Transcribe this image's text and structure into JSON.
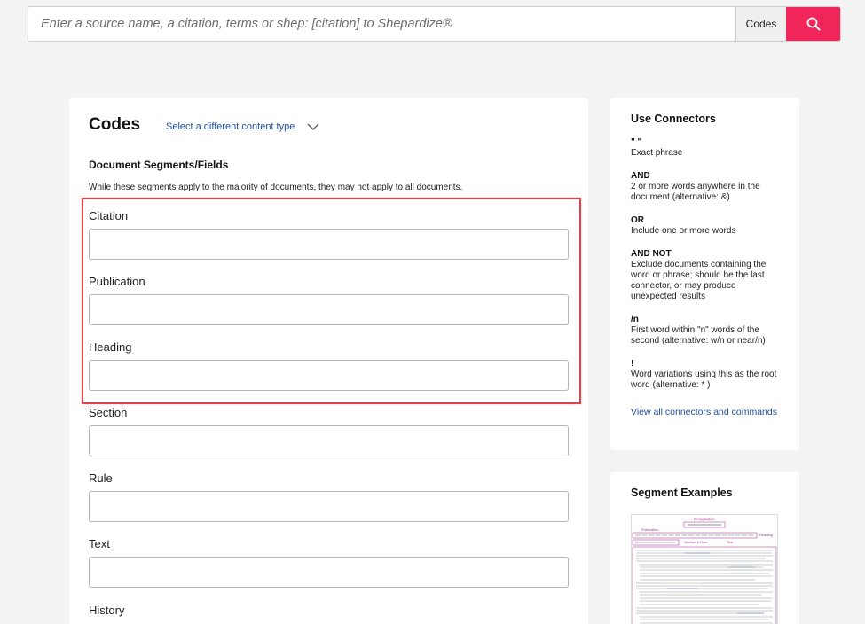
{
  "search": {
    "placeholder": "Enter a source name, a citation, terms or shep: [citation] to Shepardize®",
    "scope_label": "Codes"
  },
  "main": {
    "title": "Codes",
    "content_type_link": "Select a different content type",
    "section_heading": "Document Segments/Fields",
    "section_description": "While these segments apply to the majority of documents, they may not apply to all documents.",
    "fields": [
      {
        "label": "Citation",
        "value": ""
      },
      {
        "label": "Publication",
        "value": ""
      },
      {
        "label": "Heading",
        "value": ""
      },
      {
        "label": "Section",
        "value": ""
      },
      {
        "label": "Rule",
        "value": ""
      },
      {
        "label": "Text",
        "value": ""
      },
      {
        "label": "History",
        "value": ""
      }
    ]
  },
  "connectors": {
    "title": "Use Connectors",
    "items": [
      {
        "symbol": "\" \"",
        "description": "Exact phrase"
      },
      {
        "symbol": "AND",
        "description": "2 or more words anywhere in the document (alternative: &)"
      },
      {
        "symbol": "OR",
        "description": "Include one or more words"
      },
      {
        "symbol": "AND NOT",
        "description": "Exclude documents containing the word or phrase; should be the last connector, or may produce unexpected results"
      },
      {
        "symbol": "/n",
        "description": "First word within \"n\" words of the second (alternative: w/n or near/n)"
      },
      {
        "symbol": "!",
        "description": "Word variations using this as the root word (alternative: * )"
      }
    ],
    "link": "View all connectors and commands"
  },
  "segment_examples": {
    "title": "Segment Examples",
    "thumbnail_labels": {
      "designation": "Designation",
      "publication": "Publication",
      "heading": "Heading",
      "section": "Section & Rule",
      "text": "Text"
    }
  },
  "colors": {
    "accent": "#f0265a",
    "link": "#1f4e9c",
    "highlight": "#e2424a",
    "background": "#f3f3f3"
  }
}
